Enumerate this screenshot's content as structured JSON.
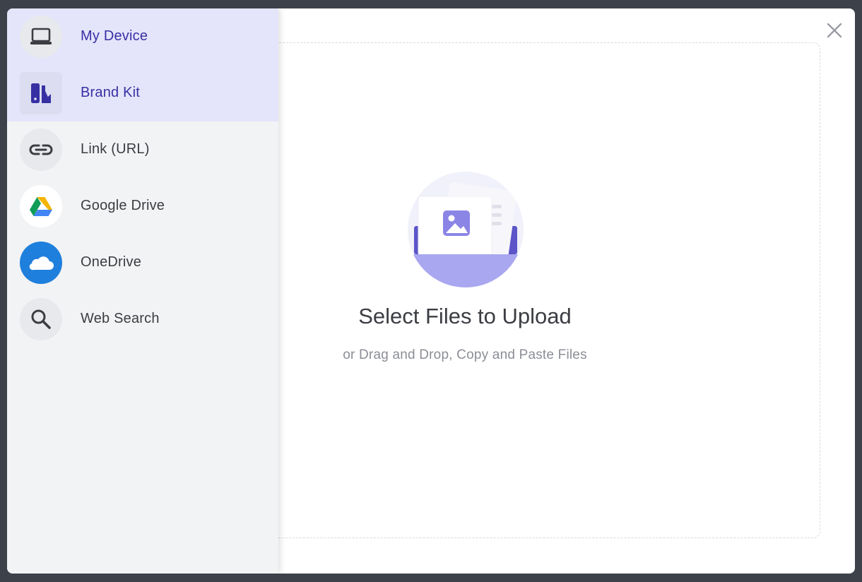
{
  "sidebar": {
    "items": [
      {
        "label": "My Device",
        "icon": "laptop-icon",
        "active": true
      },
      {
        "label": "Brand Kit",
        "icon": "brand-kit-icon",
        "active": true
      },
      {
        "label": "Link (URL)",
        "icon": "link-icon",
        "active": false
      },
      {
        "label": "Google Drive",
        "icon": "google-drive-icon",
        "active": false
      },
      {
        "label": "OneDrive",
        "icon": "onedrive-icon",
        "active": false
      },
      {
        "label": "Web Search",
        "icon": "search-icon",
        "active": false
      }
    ]
  },
  "main": {
    "title": "Select Files to Upload",
    "subtitle": "or Drag and Drop, Copy and Paste Files"
  },
  "colors": {
    "accent": "#3730a3",
    "active_bg": "#e4e5fa",
    "illustration": "#a9a7f0",
    "onedrive": "#1f7fdc"
  }
}
